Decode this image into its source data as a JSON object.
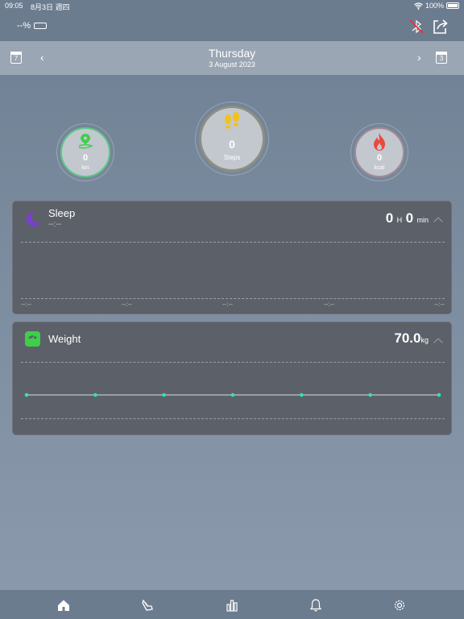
{
  "status_bar": {
    "time": "09:05",
    "date": "8月3日 週四",
    "battery": "100%"
  },
  "top_bar": {
    "device_battery": "--%",
    "icons": [
      "battery-icon",
      "bluetooth-off-icon",
      "share-icon"
    ]
  },
  "date_bar": {
    "day": "Thursday",
    "full_date": "3 August 2023",
    "left_calendar_day": "7",
    "right_calendar_day": "3"
  },
  "rings": {
    "distance": {
      "value": "0",
      "unit": "km"
    },
    "steps": {
      "value": "0",
      "unit": "Steps"
    },
    "calories": {
      "value": "0",
      "unit": "kcal"
    }
  },
  "sleep": {
    "title": "Sleep",
    "subtitle": "--:--",
    "hours": "0",
    "hours_unit": "H",
    "minutes": "0",
    "minutes_unit": "min",
    "axis_labels": [
      "--:--",
      "--:--",
      "--:--",
      "--:--",
      "--:--"
    ]
  },
  "weight": {
    "title": "Weight",
    "value": "70.0",
    "unit": "kg",
    "points": [
      70,
      70,
      70,
      70,
      70,
      70,
      70
    ]
  },
  "colors": {
    "distance_green": "#3fce4a",
    "steps_yellow": "#f2c21a",
    "fire_red": "#e84a3c",
    "sleep_purple": "#7a3fd0",
    "line_teal": "#2ee6b0"
  },
  "tabs": [
    "home-icon",
    "activity-icon",
    "stats-icon",
    "bell-icon",
    "settings-icon"
  ]
}
